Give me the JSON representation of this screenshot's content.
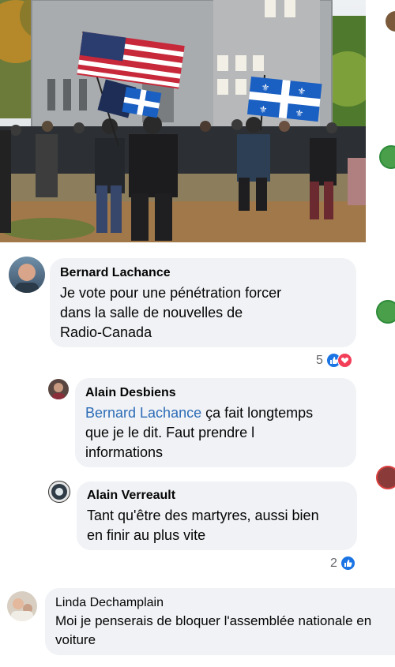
{
  "post": {
    "photo_icon": "photo-of-protest-with-flags"
  },
  "comments": [
    {
      "author": "Bernard Lachance",
      "lines": [
        "Je vote pour une pénétration forcer",
        "dans la salle de nouvelles de",
        "Radio-Canada"
      ],
      "reaction_count": "5",
      "reactions": [
        "like-icon",
        "love-icon"
      ]
    },
    {
      "author": "Alain Desbiens",
      "mention": "Bernard Lachance",
      "line1_rest": " ça fait longtemps",
      "lines": [
        "que je le dit. Faut prendre l",
        "informations"
      ]
    },
    {
      "author": "Alain Verreault",
      "lines": [
        "Tant qu'être des martyres, aussi bien",
        "en finir au plus vite"
      ],
      "reaction_count": "2",
      "reactions": [
        "like-icon"
      ]
    },
    {
      "author": "Linda Dechamplain",
      "lines": [
        "Moi je penserais de bloquer l'assemblée nationale en",
        "voiture"
      ]
    }
  ],
  "colors": {
    "bubble": "#f0f2f5",
    "mention": "#2d6cb7",
    "like": "#1b74e4",
    "love": "#f33e58",
    "meta": "#65676b"
  }
}
